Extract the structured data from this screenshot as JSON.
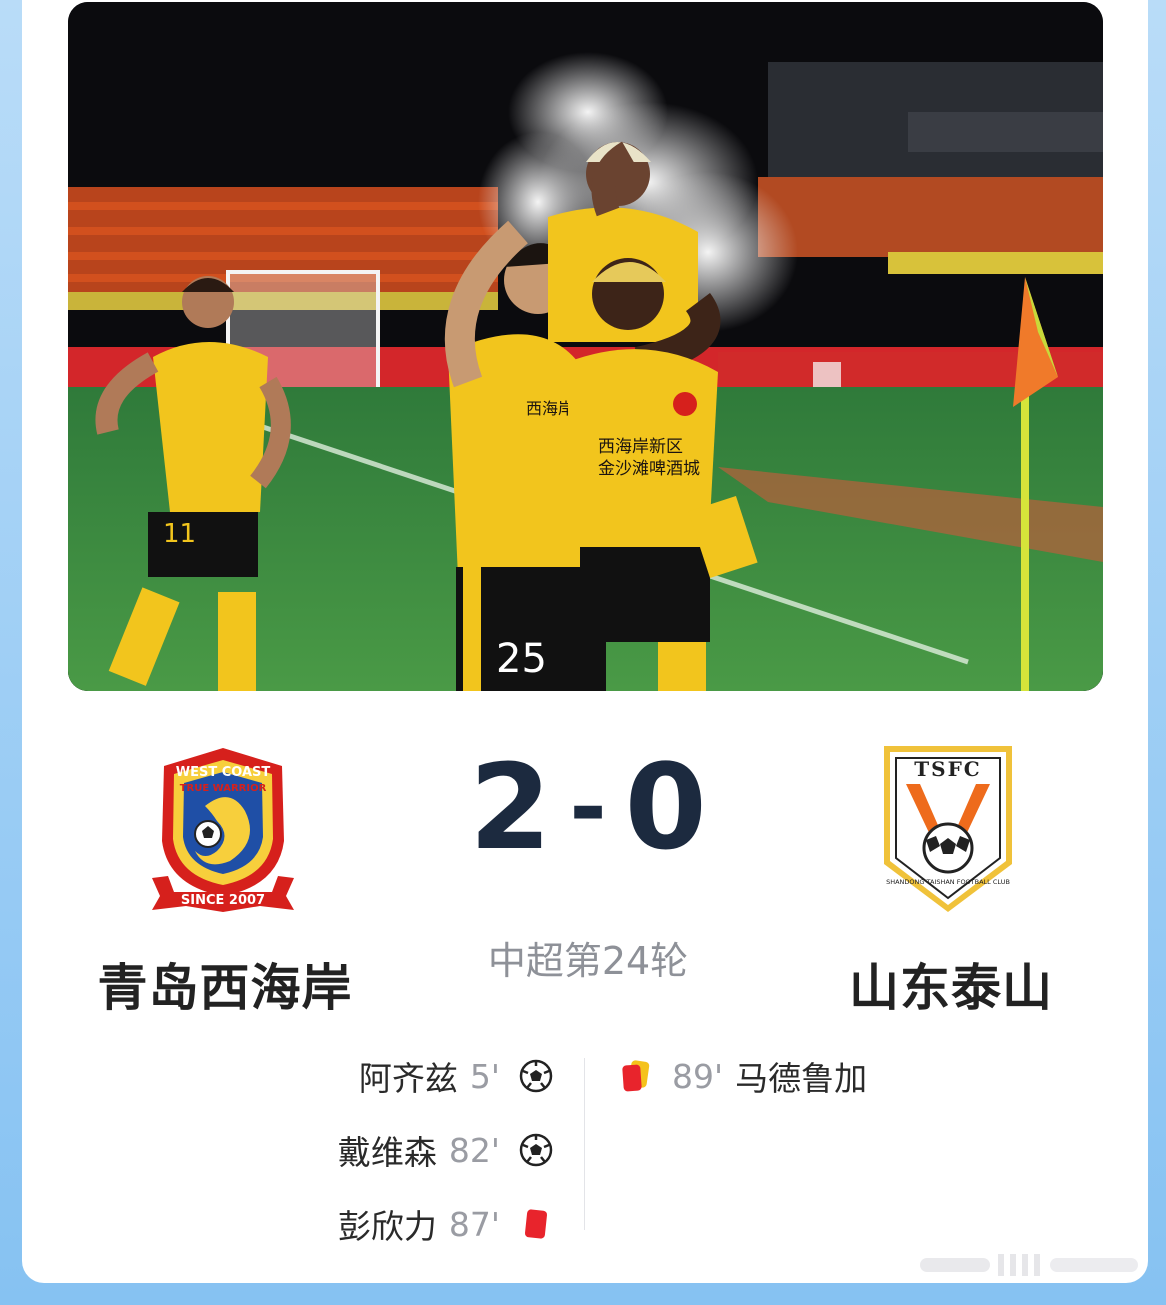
{
  "match": {
    "home_team": "青岛西海岸",
    "away_team": "山东泰山",
    "home_score": "2",
    "away_score": "0",
    "score_separator": "-",
    "round": "中超第24轮"
  },
  "crests": {
    "home": {
      "top_text": "WEST COAST",
      "ring_text": "TRUE WARRIOR",
      "banner_text": "SINCE 2007"
    },
    "away": {
      "top_text": "TSFC",
      "ring_text": "SHANDONG TAISHAN FOOTBALL CLUB"
    }
  },
  "photo": {
    "shirt_text": "西海岸新区 金沙滩啤酒城",
    "numbers": [
      "11",
      "25"
    ]
  },
  "events": {
    "home": [
      {
        "player": "阿齐兹",
        "minute": "5'",
        "icon": "soccer-ball-icon"
      },
      {
        "player": "戴维森",
        "minute": "82'",
        "icon": "soccer-ball-icon"
      },
      {
        "player": "彭欣力",
        "minute": "87'",
        "icon": "red-card-icon"
      }
    ],
    "away": [
      {
        "player": "马德鲁加",
        "minute": "89'",
        "icon": "red-yellow-card-icon"
      }
    ]
  },
  "colors": {
    "score": "#1c2a3f",
    "home_primary": "#d6201c",
    "away_primary": "#ee6b1c",
    "jersey_yellow": "#f2c51d",
    "red_card": "#e8242c",
    "yellow_card": "#f5c21b",
    "frame_blue": "#8fc7f3"
  }
}
